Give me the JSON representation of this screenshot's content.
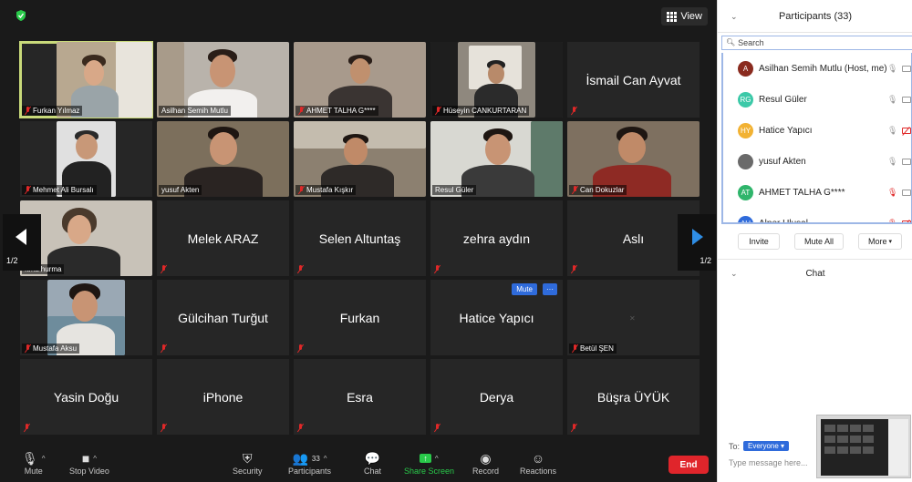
{
  "meeting": {
    "view_label": "View",
    "page_indicator_left": "1/2",
    "page_indicator_right": "1/2"
  },
  "tiles": [
    {
      "name": "Furkan Yılmaz",
      "kind": "video"
    },
    {
      "name": "Asilhan Semih Mutlu",
      "kind": "video"
    },
    {
      "name": "AHMET TALHA G****",
      "kind": "video"
    },
    {
      "name": "Hüseyin CANKURTARAN",
      "kind": "video"
    },
    {
      "name": "İsmail Can Ayvat",
      "kind": "name"
    },
    {
      "name": "Mehmet Ali Bursalı",
      "kind": "video"
    },
    {
      "name": "yusuf Akten",
      "kind": "video"
    },
    {
      "name": "Mustafa Kışkır",
      "kind": "video"
    },
    {
      "name": "Resul Güler",
      "kind": "video"
    },
    {
      "name": "Can Dokuzlar",
      "kind": "video"
    },
    {
      "name": "ıtma hurma",
      "kind": "video"
    },
    {
      "name": "Melek ARAZ",
      "kind": "name"
    },
    {
      "name": "Selen Altuntaş",
      "kind": "name"
    },
    {
      "name": "zehra aydın",
      "kind": "name"
    },
    {
      "name": "Aslı",
      "kind": "name"
    },
    {
      "name": "Mustafa Aksu",
      "kind": "video"
    },
    {
      "name": "Gülcihan Turğut",
      "kind": "name"
    },
    {
      "name": "Furkan",
      "kind": "name"
    },
    {
      "name": "Hatice Yapıcı",
      "kind": "name",
      "mute_label": "Mute",
      "more_label": "···"
    },
    {
      "name": "Betül ŞEN",
      "kind": "blank"
    },
    {
      "name": "Yasin Doğu",
      "kind": "name"
    },
    {
      "name": "iPhone",
      "kind": "name"
    },
    {
      "name": "Esra",
      "kind": "name"
    },
    {
      "name": "Derya",
      "kind": "name"
    },
    {
      "name": "Büşra ÜYÜK",
      "kind": "name"
    }
  ],
  "toolbar": {
    "mute": "Mute",
    "stop_video": "Stop Video",
    "security": "Security",
    "participants": "Participants",
    "participants_count": "33",
    "chat": "Chat",
    "share_screen": "Share Screen",
    "record": "Record",
    "reactions": "Reactions",
    "end": "End"
  },
  "participants_panel": {
    "title": "Participants (33)",
    "search_placeholder": "Search",
    "list": [
      {
        "initials": "A",
        "name": "Asilhan Semih Mutlu (Host, me)",
        "color": "#8a2b1f",
        "mic_red": false,
        "cam_red": false
      },
      {
        "initials": "RG",
        "name": "Resul Güler",
        "color": "#3cc9a8",
        "mic_red": false,
        "cam_red": false
      },
      {
        "initials": "HY",
        "name": "Hatice Yapıcı",
        "color": "#f2b233",
        "mic_red": false,
        "cam_red": true
      },
      {
        "initials": "",
        "name": "yusuf Akten",
        "color": "#6a6a6a",
        "mic_red": false,
        "cam_red": false
      },
      {
        "initials": "AT",
        "name": "AHMET TALHA G****",
        "color": "#2fb56b",
        "mic_red": true,
        "cam_red": false
      },
      {
        "initials": "AU",
        "name": "Alper Ulusal",
        "color": "#2f6bdb",
        "mic_red": true,
        "cam_red": true
      }
    ],
    "invite": "Invite",
    "mute_all": "Mute All",
    "more": "More"
  },
  "chat_panel": {
    "title": "Chat",
    "to_label": "To:",
    "recipient": "Everyone",
    "input_placeholder": "Type message here..."
  },
  "colors": {
    "active_speaker": "#c9da7a",
    "accent_blue": "#2f6bdb",
    "end_red": "#e0252b",
    "share_green": "#29c94a"
  }
}
